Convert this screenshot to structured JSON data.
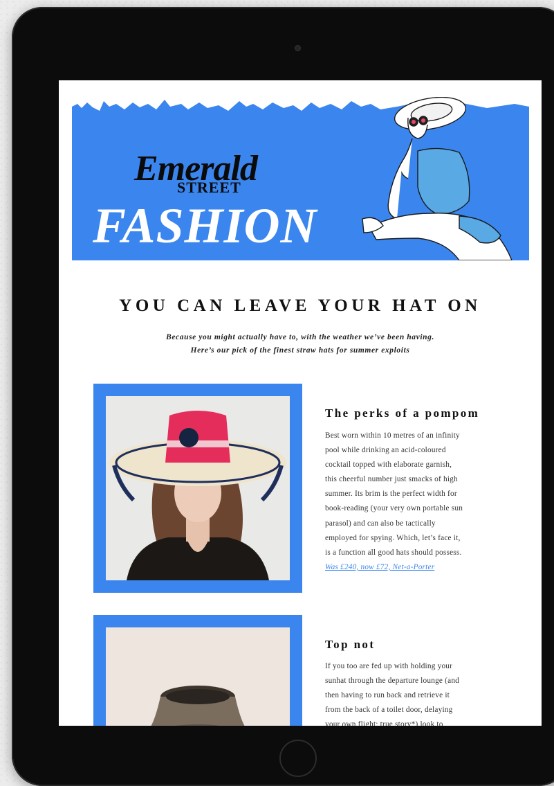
{
  "colors": {
    "accent": "#3b86ee",
    "bezel": "#0c0c0c",
    "screen": "#ffffff"
  },
  "banner": {
    "brand_top": "Emerald",
    "brand_sub": "STREET",
    "section": "FASHION"
  },
  "article": {
    "headline": "YOU CAN LEAVE YOUR HAT ON",
    "intro_line1": "Because you might actually have to, with the weather we’ve been having.",
    "intro_line2": "Here’s our pick of the finest straw hats for summer exploits"
  },
  "items": [
    {
      "title": "The perks of a pompom",
      "body_lines": [
        "Best worn within 10 metres of an infinity",
        "pool while drinking an acid-coloured",
        "cocktail topped with elaborate garnish,",
        "this cheerful number just smacks of high",
        "summer. Its brim is the perfect width for",
        "book-reading (your very own portable sun",
        "parasol) and can also be tactically",
        "employed for spying. Which, let’s face it,",
        "is a function all good hats should possess."
      ],
      "link": "Was £240, now £72, Net-a-Porter"
    },
    {
      "title": "Top not",
      "body_lines": [
        "If you too are fed up with holding your",
        "sunhat through the departure lounge (and",
        "then having to run back and retrieve it",
        "from the back of a toilet door, delaying",
        "your own flight; true story*) look to"
      ]
    }
  ]
}
